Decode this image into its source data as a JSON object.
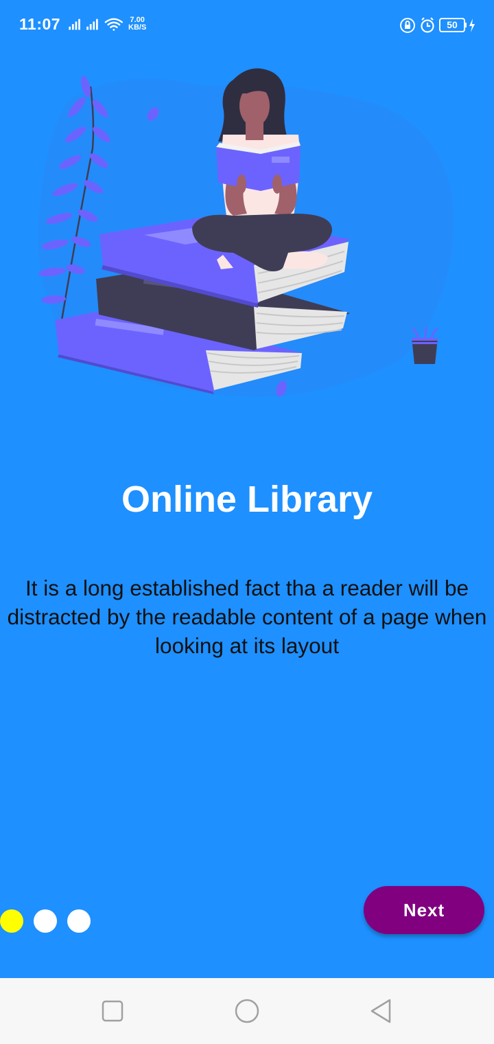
{
  "status_bar": {
    "time": "11:07",
    "network_speed_value": "7.00",
    "network_speed_unit": "KB/S",
    "battery_level": "50"
  },
  "onboarding": {
    "title": "Online Library",
    "description": "It is a long established fact tha a reader will be distracted by the readable content of a page when looking at its layout",
    "page_indicator": {
      "current": 1,
      "total": 3
    },
    "next_label": "Next"
  },
  "colors": {
    "background": "#1e90ff",
    "active_dot": "#ffff00",
    "inactive_dot": "#ffffff",
    "next_button": "#800080",
    "book_purple": "#6c63ff",
    "book_dark": "#3f3d56"
  },
  "icons": {
    "status": [
      "signal-icon",
      "signal-icon",
      "wifi-icon",
      "lock-rotation-icon",
      "alarm-icon",
      "battery-icon",
      "charging-icon"
    ],
    "nav": [
      "recent-apps-icon",
      "home-icon",
      "back-icon"
    ]
  }
}
